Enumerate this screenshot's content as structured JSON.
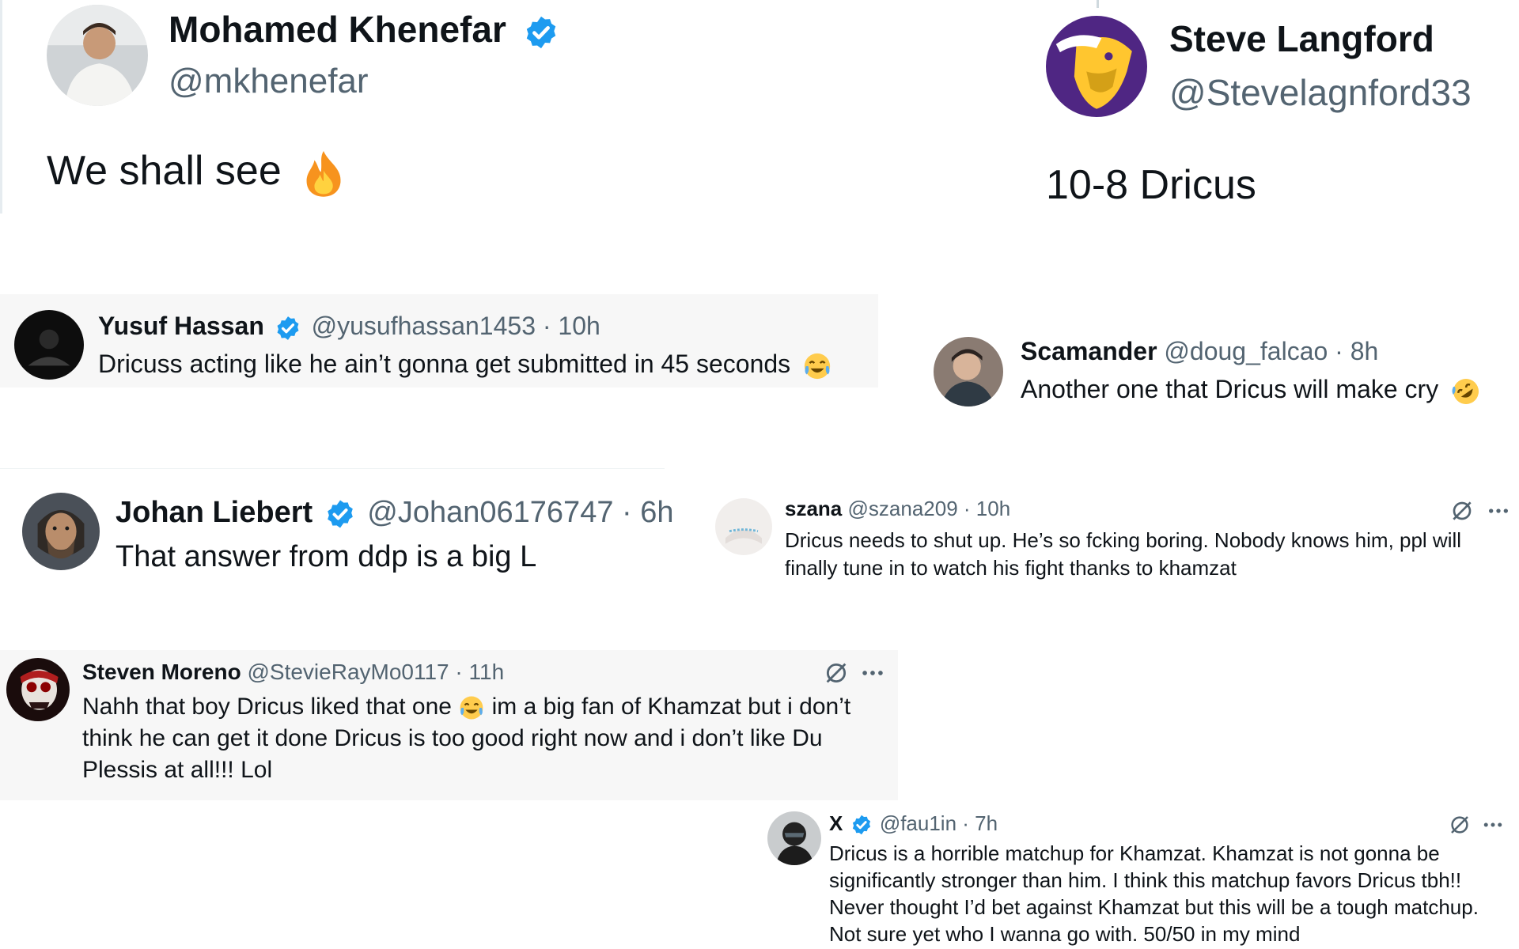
{
  "tweets": [
    {
      "name": "Mohamed Khenefar",
      "handle": "@mkhenefar",
      "verified": true,
      "text": "We shall see",
      "emoji": "fire-emoji"
    },
    {
      "name": "Steve Langford",
      "handle": "@Stevelagnford33",
      "verified": false,
      "text": "10-8 Dricus"
    },
    {
      "name": "Yusuf Hassan",
      "handle": "@yusufhassan1453",
      "time": "· 10h",
      "verified": true,
      "text": "Dricuss acting like he ain’t gonna get submitted in 45 seconds",
      "emoji": "tears-of-joy-emoji"
    },
    {
      "name": "Scamander",
      "handle": "@doug_falcao",
      "time": "· 8h",
      "verified": false,
      "text": "Another one that Dricus will make cry",
      "emoji": "rofl-emoji"
    },
    {
      "name": "Johan Liebert",
      "handle": "@Johan06176747",
      "time": "· 6h",
      "verified": true,
      "text": "That answer from ddp is a big L"
    },
    {
      "name": "szana",
      "handle": "@szana209",
      "time": "· 10h",
      "verified": false,
      "text": "Dricus needs to shut up. He’s so fcking boring. Nobody knows him, ppl will finally tune in to watch his fight thanks to khamzat"
    },
    {
      "name": "Steven Moreno",
      "handle": "@StevieRayMo0117",
      "time": "· 11h",
      "verified": false,
      "text_a": "Nahh that boy Dricus liked that one",
      "text_b": " im a big fan of Khamzat but i don’t think he can get it done Dricus is too good right now and i don’t like Du Plessis at all!!! Lol",
      "emoji": "tears-of-joy-emoji"
    },
    {
      "name": "X",
      "handle": "@fau1in",
      "time": "· 7h",
      "verified": true,
      "text": "Dricus is a horrible matchup for Khamzat. Khamzat is not gonna be significantly stronger than him. I think this matchup favors Dricus tbh!! Never thought I’d bet against Khamzat but this will be a tough matchup. Not sure yet who I wanna go with. 50/50 in my mind"
    }
  ],
  "colors": {
    "verified": "#1d9bf0",
    "text": "#0f1419",
    "secondary": "#536471",
    "card_bg": "#f7f7f7"
  },
  "action_icons": [
    "grok-icon",
    "more-icon"
  ]
}
